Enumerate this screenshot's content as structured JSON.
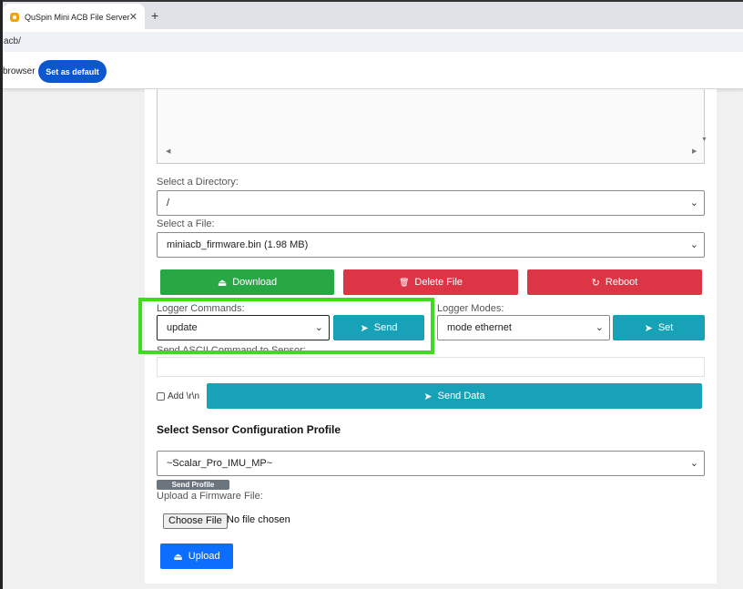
{
  "browser": {
    "tab_title": "QuSpin Mini ACB File Server",
    "tab_close": "✕",
    "new_tab": "+",
    "address": "acb/",
    "infobar_text": "browser",
    "set_default_label": "Set as default"
  },
  "files": {
    "directory_label": "Select a Directory:",
    "directory_value": "/",
    "file_label": "Select a File:",
    "file_value": "miniacb_firmware.bin (1.98 MB)",
    "download_label": "Download",
    "delete_label": "Delete File",
    "reboot_label": "Reboot"
  },
  "logger": {
    "commands_label": "Logger Commands:",
    "command_value": "update",
    "send_label": "Send",
    "modes_label": "Logger Modes:",
    "mode_value": "mode ethernet",
    "set_label": "Set"
  },
  "ascii": {
    "label": "Send ASCII Command to Sensor:",
    "add_crlf_label": "Add \\r\\n",
    "send_data_label": "Send Data"
  },
  "profile": {
    "heading": "Select Sensor Configuration Profile",
    "profile_value": "~Scalar_Pro_IMU_MP~",
    "send_profile_label": "Send Profile"
  },
  "firmware": {
    "label": "Upload a Firmware File:",
    "choose_file_label": "Choose File",
    "no_file_text": "No file chosen",
    "upload_label": "Upload"
  },
  "icons": {
    "chevron": "⌄",
    "send": "➤",
    "reboot": "↻",
    "delete": "🗑",
    "upload": "⏏"
  },
  "colors": {
    "green": "#28a745",
    "red": "#dc3545",
    "teal": "#17a2b8",
    "blue": "#0d6efd",
    "highlight": "#3ddc1e"
  }
}
